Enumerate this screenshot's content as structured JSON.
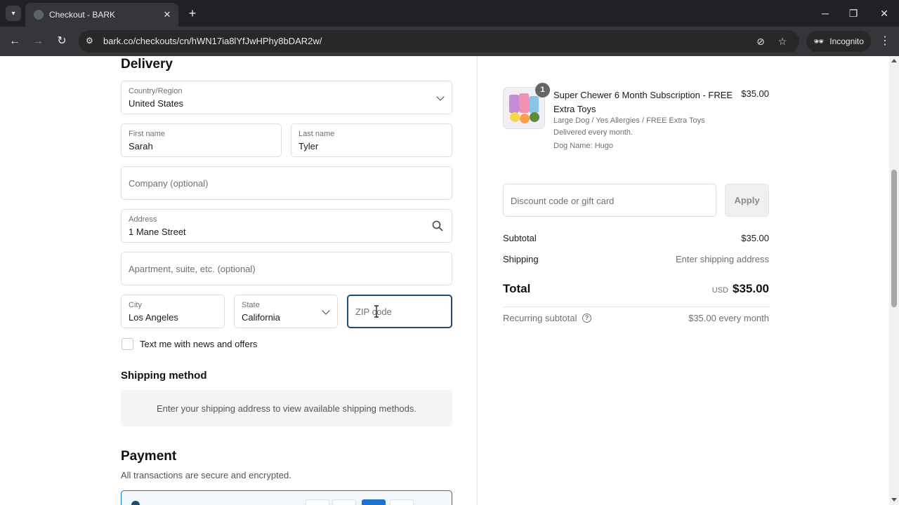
{
  "browser": {
    "tab_title": "Checkout - BARK",
    "url": "bark.co/checkouts/cn/hWN17ia8lYfJwHPhy8bDAR2w/",
    "incognito_label": "Incognito"
  },
  "delivery": {
    "heading": "Delivery",
    "country": {
      "label": "Country/Region",
      "value": "United States"
    },
    "first_name": {
      "label": "First name",
      "value": "Sarah"
    },
    "last_name": {
      "label": "Last name",
      "value": "Tyler"
    },
    "company": {
      "placeholder": "Company (optional)"
    },
    "address": {
      "label": "Address",
      "value": "1 Mane Street"
    },
    "apartment": {
      "placeholder": "Apartment, suite, etc. (optional)"
    },
    "city": {
      "label": "City",
      "value": "Los Angeles"
    },
    "state": {
      "label": "State",
      "value": "California"
    },
    "zip": {
      "placeholder": "ZIP code",
      "value": ""
    },
    "text_me_label": "Text me with news and offers"
  },
  "shipping_method": {
    "heading": "Shipping method",
    "message": "Enter your shipping address to view available shipping methods."
  },
  "payment": {
    "heading": "Payment",
    "subtitle": "All transactions are secure and encrypted."
  },
  "summary": {
    "item": {
      "quantity": "1",
      "name": "Super Chewer 6 Month Subscription - FREE Extra Toys",
      "price": "$35.00",
      "variant": "Large Dog / Yes Allergies / FREE Extra Toys",
      "delivery": "Delivered every month.",
      "dog_name": "Dog Name: Hugo"
    },
    "discount_placeholder": "Discount code or gift card",
    "apply_label": "Apply",
    "subtotal_label": "Subtotal",
    "subtotal_value": "$35.00",
    "shipping_label": "Shipping",
    "shipping_value": "Enter shipping address",
    "total_label": "Total",
    "total_currency": "USD",
    "total_value": "$35.00",
    "recurring_label": "Recurring subtotal",
    "recurring_value": "$35.00 every month"
  },
  "colors": {
    "focus_border": "#1e4b73",
    "chrome_dark": "#202124"
  }
}
